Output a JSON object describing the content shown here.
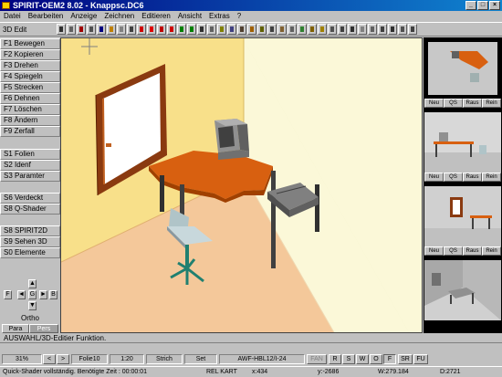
{
  "window": {
    "title": "SPIRIT-OEM2 8.02 - Knappsc.DC6",
    "min": "_",
    "max": "□",
    "close": "×"
  },
  "menu": [
    "Datei",
    "Bearbeiten",
    "Anzeige",
    "Zeichnen",
    "Editieren",
    "Ansicht",
    "Extras",
    "?"
  ],
  "toolbar": {
    "mode": "3D Edit"
  },
  "sidebar": {
    "keys": [
      "F1  Bewegen",
      "F2  Kopieren",
      "F3  Drehen",
      "F4  Spiegeln",
      "F5  Strecken",
      "F6  Dehnen",
      "F7  Löschen",
      "F8  Ändern",
      "F9  Zerfall",
      "S1  Folien",
      "S2  Idenf",
      "S3  Paramter",
      "S6  Verdeckt",
      "S8  Q-Shader",
      "S8  SPIRIT2D",
      "S9  Sehen 3D",
      "S0  Elemente"
    ],
    "nav": {
      "up": "▲",
      "down": "▼",
      "left": "◄",
      "right": "►",
      "center": "G",
      "f": "F",
      "b": "B"
    },
    "ortho": "Ortho",
    "para": "Para",
    "pers": "Pers"
  },
  "previews": [
    {
      "btns": [
        "Neu",
        "QS",
        "Raus",
        "Rein"
      ]
    },
    {
      "btns": [
        "Neu",
        "QS",
        "Raus",
        "Rein"
      ]
    },
    {
      "btns": [
        "Neu",
        "QS",
        "Raus",
        "Rein"
      ]
    },
    {
      "btns": [
        "Neu",
        "QS",
        "Raus",
        "Rein"
      ]
    }
  ],
  "hint": "AUSWAHL/3D-Editier Funktion.",
  "status": {
    "zoom": "31%",
    "prev": "<",
    "next": ">",
    "folie": "Folie10",
    "scale": "1:20",
    "line": "Strich",
    "set": "Set",
    "layer": "AWF-HBL12/I-24",
    "fang": "FAN",
    "r": "R",
    "s": "S",
    "w": "W",
    "o": "O",
    "f": "F",
    "sr": "SR",
    "fu": "FU"
  },
  "info": {
    "msg": "Quick-Shader vollständig. Benötigte Zeit : 00:00:01",
    "mode": "REL KART",
    "x": "x:434",
    "y": "y:-2686",
    "w": "W:279.184",
    "d": "D:2721"
  },
  "colors": {
    "wall_left": "#f8e08a",
    "wall_right": "#fbf8d8",
    "floor": "#f4c89a",
    "desk": "#d86010",
    "window_frame": "#8a3a10"
  }
}
